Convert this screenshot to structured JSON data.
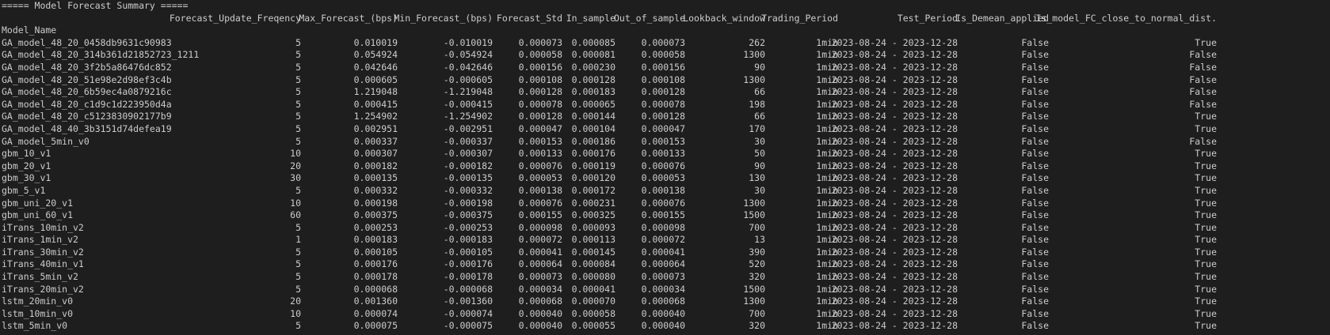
{
  "terminal": {
    "title_line": "===== Model Forecast Summary =====",
    "index_label": "Model_Name",
    "columns": [
      "Forecast_Update_Freqency",
      "Max_Forecast_(bps)",
      "Min_Forecast_(bps)",
      "Forecast_Std",
      "In_sample",
      "Out_of_sample",
      "Lookback_window",
      "Trading_Period",
      "Test_Period",
      "Is_Demean_applied",
      "Is_model_FC_close_to_normal_dist."
    ],
    "rows": [
      [
        "GA_model_48_20_0458db9631c90983",
        "5",
        "0.010019",
        "-0.010019",
        "0.000073",
        "0.000085",
        "0.000073",
        "262",
        "1min",
        "2023-08-24 - 2023-12-28",
        "False",
        "True"
      ],
      [
        "GA_model_48_20_314b361d21852723_1211",
        "5",
        "0.054924",
        "-0.054924",
        "0.000058",
        "0.000081",
        "0.000058",
        "1300",
        "1min",
        "2023-08-24 - 2023-12-28",
        "False",
        "False"
      ],
      [
        "GA_model_48_20_3f2b5a86476dc852",
        "5",
        "0.042646",
        "-0.042646",
        "0.000156",
        "0.000230",
        "0.000156",
        "90",
        "1min",
        "2023-08-24 - 2023-12-28",
        "False",
        "False"
      ],
      [
        "GA_model_48_20_51e98e2d98ef3c4b",
        "5",
        "0.000605",
        "-0.000605",
        "0.000108",
        "0.000128",
        "0.000108",
        "1300",
        "1min",
        "2023-08-24 - 2023-12-28",
        "False",
        "False"
      ],
      [
        "GA_model_48_20_6b59ec4a0879216c",
        "5",
        "1.219048",
        "-1.219048",
        "0.000128",
        "0.000183",
        "0.000128",
        "66",
        "1min",
        "2023-08-24 - 2023-12-28",
        "False",
        "False"
      ],
      [
        "GA_model_48_20_c1d9c1d223950d4a",
        "5",
        "0.000415",
        "-0.000415",
        "0.000078",
        "0.000065",
        "0.000078",
        "198",
        "1min",
        "2023-08-24 - 2023-12-28",
        "False",
        "False"
      ],
      [
        "GA_model_48_20_c5123830902177b9",
        "5",
        "1.254902",
        "-1.254902",
        "0.000128",
        "0.000144",
        "0.000128",
        "66",
        "1min",
        "2023-08-24 - 2023-12-28",
        "False",
        "True"
      ],
      [
        "GA_model_48_40_3b3151d74defea19",
        "5",
        "0.002951",
        "-0.002951",
        "0.000047",
        "0.000104",
        "0.000047",
        "170",
        "1min",
        "2023-08-24 - 2023-12-28",
        "False",
        "True"
      ],
      [
        "GA_model_5min_v0",
        "5",
        "0.000337",
        "-0.000337",
        "0.000153",
        "0.000186",
        "0.000153",
        "30",
        "1min",
        "2023-08-24 - 2023-12-28",
        "False",
        "False"
      ],
      [
        "gbm_10_v1",
        "10",
        "0.000307",
        "-0.000307",
        "0.000133",
        "0.000176",
        "0.000133",
        "50",
        "1min",
        "2023-08-24 - 2023-12-28",
        "False",
        "True"
      ],
      [
        "gbm_20_v1",
        "20",
        "0.000182",
        "-0.000182",
        "0.000076",
        "0.000119",
        "0.000076",
        "90",
        "1min",
        "2023-08-24 - 2023-12-28",
        "False",
        "True"
      ],
      [
        "gbm_30_v1",
        "30",
        "0.000135",
        "-0.000135",
        "0.000053",
        "0.000120",
        "0.000053",
        "130",
        "1min",
        "2023-08-24 - 2023-12-28",
        "False",
        "True"
      ],
      [
        "gbm_5_v1",
        "5",
        "0.000332",
        "-0.000332",
        "0.000138",
        "0.000172",
        "0.000138",
        "30",
        "1min",
        "2023-08-24 - 2023-12-28",
        "False",
        "True"
      ],
      [
        "gbm_uni_20_v1",
        "10",
        "0.000198",
        "-0.000198",
        "0.000076",
        "0.000231",
        "0.000076",
        "1300",
        "1min",
        "2023-08-24 - 2023-12-28",
        "False",
        "True"
      ],
      [
        "gbm_uni_60_v1",
        "60",
        "0.000375",
        "-0.000375",
        "0.000155",
        "0.000325",
        "0.000155",
        "1500",
        "1min",
        "2023-08-24 - 2023-12-28",
        "False",
        "True"
      ],
      [
        "iTrans_10min_v2",
        "5",
        "0.000253",
        "-0.000253",
        "0.000098",
        "0.000093",
        "0.000098",
        "700",
        "1min",
        "2023-08-24 - 2023-12-28",
        "False",
        "True"
      ],
      [
        "iTrans_1min_v2",
        "1",
        "0.000183",
        "-0.000183",
        "0.000072",
        "0.000113",
        "0.000072",
        "13",
        "1min",
        "2023-08-24 - 2023-12-28",
        "False",
        "True"
      ],
      [
        "iTrans_30min_v2",
        "5",
        "0.000105",
        "-0.000105",
        "0.000041",
        "0.000145",
        "0.000041",
        "390",
        "1min",
        "2023-08-24 - 2023-12-28",
        "False",
        "True"
      ],
      [
        "iTrans_40min_v1",
        "5",
        "0.000176",
        "-0.000176",
        "0.000064",
        "0.000084",
        "0.000064",
        "520",
        "1min",
        "2023-08-24 - 2023-12-28",
        "False",
        "True"
      ],
      [
        "iTrans_5min_v2",
        "5",
        "0.000178",
        "-0.000178",
        "0.000073",
        "0.000080",
        "0.000073",
        "320",
        "1min",
        "2023-08-24 - 2023-12-28",
        "False",
        "True"
      ],
      [
        "iTrans_20min_v2",
        "5",
        "0.000068",
        "-0.000068",
        "0.000034",
        "0.000041",
        "0.000034",
        "1500",
        "1min",
        "2023-08-24 - 2023-12-28",
        "False",
        "True"
      ],
      [
        "lstm_20min_v0",
        "20",
        "0.001360",
        "-0.001360",
        "0.000068",
        "0.000070",
        "0.000068",
        "1300",
        "1min",
        "2023-08-24 - 2023-12-28",
        "False",
        "True"
      ],
      [
        "lstm_10min_v0",
        "10",
        "0.000074",
        "-0.000074",
        "0.000040",
        "0.000058",
        "0.000040",
        "700",
        "1min",
        "2023-08-24 - 2023-12-28",
        "False",
        "True"
      ],
      [
        "lstm_5min_v0",
        "5",
        "0.000075",
        "-0.000075",
        "0.000040",
        "0.000055",
        "0.000040",
        "320",
        "1min",
        "2023-08-24 - 2023-12-28",
        "False",
        "True"
      ]
    ]
  }
}
